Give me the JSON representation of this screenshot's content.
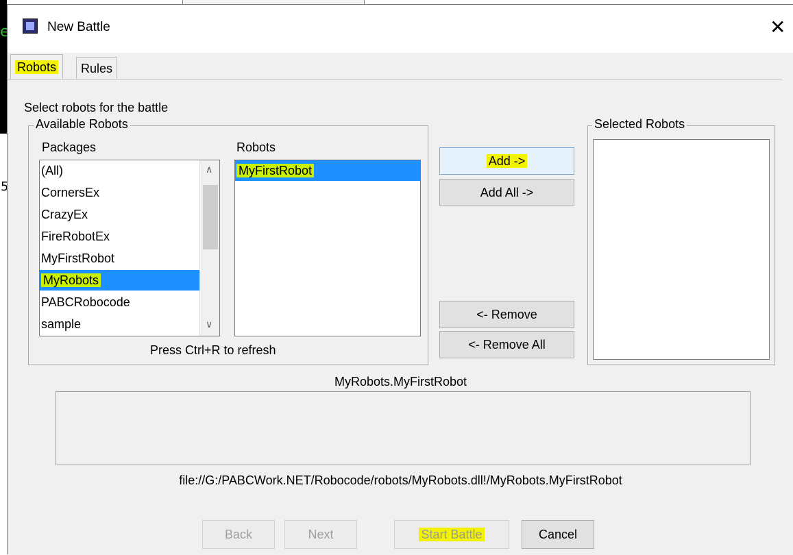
{
  "background": {
    "fragment_char": "e",
    "fragment_digit": "5"
  },
  "window": {
    "title": "New Battle",
    "close_glyph": "✕"
  },
  "tabs": [
    {
      "label": "Robots",
      "active": true,
      "highlighted": true
    },
    {
      "label": "Rules",
      "active": false
    }
  ],
  "robots_tab": {
    "hint": "Select robots for the battle",
    "available_group": "Available Robots",
    "packages_label": "Packages",
    "robots_label": "Robots",
    "packages": [
      "(All)",
      "CornersEx",
      "CrazyEx",
      "FireRobotEx",
      "MyFirstRobot",
      "MyRobots",
      "PABCRobocode",
      "sample"
    ],
    "selected_package": "MyRobots",
    "robots": [
      "MyFirstRobot"
    ],
    "selected_robot": "MyFirstRobot",
    "refresh_hint": "Press Ctrl+R to refresh",
    "buttons": {
      "add": "Add ->",
      "add_all": "Add All ->",
      "remove": "<- Remove",
      "remove_all": "<- Remove All"
    },
    "selected_group": "Selected Robots",
    "selected_robots": [],
    "current_robot": "MyRobots.MyFirstRobot",
    "description": "",
    "file_path": "file://G:/PABCWork.NET/Robocode/robots/MyRobots.dll!/MyRobots.MyFirstRobot"
  },
  "footer": {
    "back": "Back",
    "next": "Next",
    "start_battle": "Start Battle",
    "cancel": "Cancel"
  },
  "colors": {
    "highlight": "#f6f600",
    "selection": "#1e90ff",
    "dialog_bg": "#f0f0f0"
  }
}
